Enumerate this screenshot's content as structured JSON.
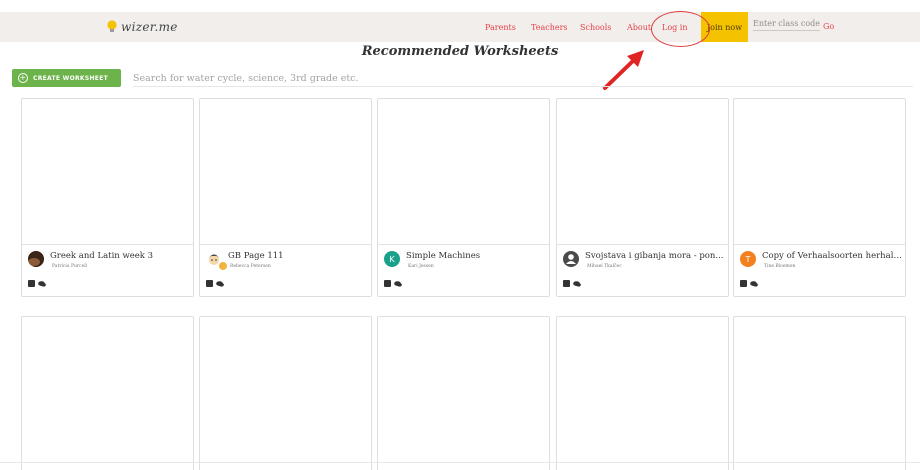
{
  "brand": {
    "name": "wizer.me"
  },
  "nav": {
    "parents": "Parents",
    "teachers": "Teachers",
    "schools": "Schools",
    "about": "About",
    "login": "Log in",
    "join": "Join now",
    "class_code_placeholder": "Enter class code",
    "go": "Go"
  },
  "page": {
    "title": "Recommended Worksheets"
  },
  "toolbar": {
    "create_label": "CREATE WORKSHEET",
    "search_placeholder": "Search for water cycle, science, 3rd grade etc."
  },
  "worksheets": [
    {
      "title": "Greek and Latin week 3",
      "author": "Patricia Purcell",
      "avatar": ""
    },
    {
      "title": "GB Page 111",
      "author": "Rebecca Petersen",
      "avatar": ""
    },
    {
      "title": "Simple Machines",
      "author": "Kari Jessen",
      "avatar": "K"
    },
    {
      "title": "Svojstava i gibanja mora - pon...",
      "author": "Mihael Tkalčec",
      "avatar": ""
    },
    {
      "title": "Copy of Verhaalsoorten herhali...",
      "author": "Tine Bloemen",
      "avatar": "T"
    }
  ],
  "colors": {
    "accent_red": "#e5414b",
    "join_yellow": "#f5c200",
    "create_green": "#6bb34a",
    "highlight_red": "#e03c3c"
  }
}
